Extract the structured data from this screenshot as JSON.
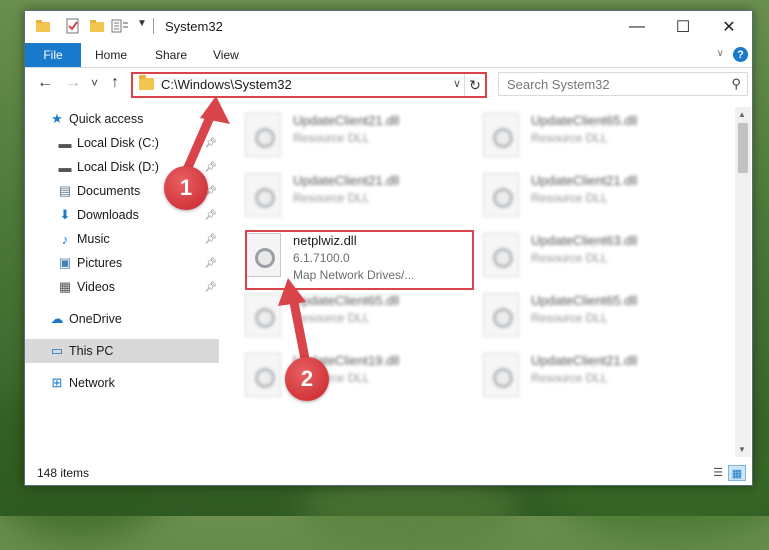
{
  "window": {
    "title": "System32",
    "controls": {
      "minimize": "—",
      "maximize": "☐",
      "close": "✕"
    }
  },
  "ribbon": {
    "tabs": [
      "File",
      "Home",
      "Share",
      "View"
    ]
  },
  "nav": {
    "back": "←",
    "forward": "→",
    "recent": "˅",
    "up": "↑",
    "address": "C:\\Windows\\System32",
    "search_placeholder": "Search System32"
  },
  "sidebar": {
    "items": [
      {
        "label": "Quick access",
        "icon": "star-icon",
        "glyph": "★",
        "color": "#1979ca",
        "pinned": false
      },
      {
        "label": "Local Disk (C:)",
        "icon": "drive-icon",
        "glyph": "▬",
        "color": "#555",
        "pinned": true
      },
      {
        "label": "Local Disk (D:)",
        "icon": "drive-icon",
        "glyph": "▬",
        "color": "#555",
        "pinned": true
      },
      {
        "label": "Documents",
        "icon": "documents-icon",
        "glyph": "▤",
        "color": "#5f7a93",
        "pinned": true
      },
      {
        "label": "Downloads",
        "icon": "downloads-icon",
        "glyph": "⬇",
        "color": "#1979ca",
        "pinned": true
      },
      {
        "label": "Music",
        "icon": "music-icon",
        "glyph": "♪",
        "color": "#1979ca",
        "pinned": true
      },
      {
        "label": "Pictures",
        "icon": "pictures-icon",
        "glyph": "▣",
        "color": "#4a7fb3",
        "pinned": true
      },
      {
        "label": "Videos",
        "icon": "videos-icon",
        "glyph": "▦",
        "color": "#555",
        "pinned": true
      },
      {
        "label": "OneDrive",
        "icon": "onedrive-icon",
        "glyph": "☁",
        "color": "#1979ca",
        "pinned": false
      },
      {
        "label": "This PC",
        "icon": "this-pc-icon",
        "glyph": "▭",
        "color": "#1979ca",
        "pinned": false
      },
      {
        "label": "Network",
        "icon": "network-icon",
        "glyph": "⊞",
        "color": "#1979ca",
        "pinned": false
      }
    ]
  },
  "files": [
    {
      "name": "UpdateClient21.dll",
      "meta1": "Resource DLL",
      "meta2": ""
    },
    {
      "name": "UpdateClient65.dll",
      "meta1": "Resource DLL",
      "meta2": ""
    },
    {
      "name": "UpdateClient21.dll",
      "meta1": "Resource DLL",
      "meta2": ""
    },
    {
      "name": "UpdateClient21.dll",
      "meta1": "Resource DLL",
      "meta2": ""
    },
    {
      "name": "netplwiz.dll",
      "meta1": "6.1.7100.0",
      "meta2": "Map Network Drives/..."
    },
    {
      "name": "UpdateClient63.dll",
      "meta1": "Resource DLL",
      "meta2": ""
    },
    {
      "name": "UpdateClient65.dll",
      "meta1": "Resource DLL",
      "meta2": ""
    },
    {
      "name": "UpdateClient65.dll",
      "meta1": "Resource DLL",
      "meta2": ""
    },
    {
      "name": "UpdateClient19.dll",
      "meta1": "Resource DLL",
      "meta2": ""
    },
    {
      "name": "UpdateClient21.dll",
      "meta1": "Resource DLL",
      "meta2": ""
    }
  ],
  "status": {
    "count": "148 items"
  },
  "annotations": {
    "badge1": "1",
    "badge2": "2",
    "color": "#d9434a"
  }
}
